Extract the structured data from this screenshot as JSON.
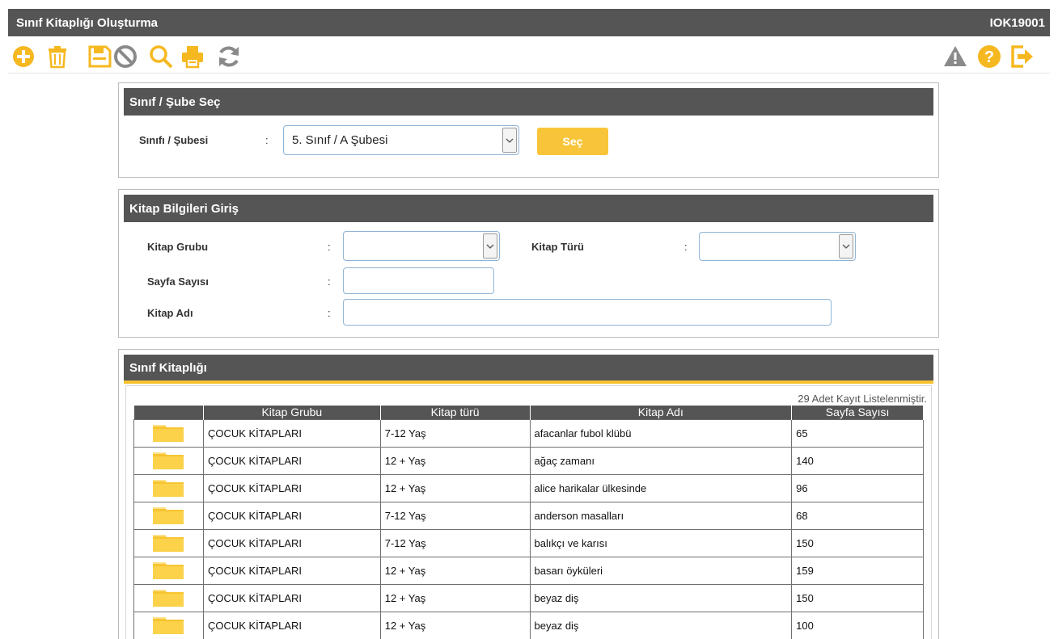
{
  "window": {
    "title": "Sınıf Kitaplığı Oluşturma",
    "code": "IOK19001"
  },
  "toolbar": {
    "left_icons": [
      "add-icon",
      "trash-icon",
      "save-icon",
      "cancel-icon",
      "search-icon",
      "print-icon",
      "refresh-icon"
    ],
    "right_icons": [
      "warning-icon",
      "help-icon",
      "exit-icon"
    ],
    "colors": {
      "accent": "#f6b820",
      "grey": "#8a8a8a"
    }
  },
  "class_panel": {
    "title": "Sınıf / Şube  Seç",
    "label": "Sınıfı / Şubesi",
    "colon": ":",
    "selected": "5. Sınıf / A Şubesi",
    "button": "Seç"
  },
  "book_panel": {
    "title": "Kitap Bilgileri Giriş",
    "colon": ":",
    "group_label": "Kitap Grubu",
    "group_value": "",
    "type_label": "Kitap Türü",
    "type_value": "",
    "pages_label": "Sayfa Sayısı",
    "pages_value": "",
    "name_label": "Kitap Adı",
    "name_value": ""
  },
  "library_panel": {
    "title": "Sınıf Kitaplığı",
    "count_text": "29 Adet Kayıt Listelenmiştir.",
    "columns": [
      "",
      "Kitap Grubu",
      "Kitap türü",
      "Kitap Adı",
      "Sayfa Sayısı"
    ],
    "rows": [
      {
        "group": "ÇOCUK KİTAPLARI",
        "type": "7-12 Yaş",
        "name": "afacanlar fubol klübü",
        "pages": "65"
      },
      {
        "group": "ÇOCUK KİTAPLARI",
        "type": "12 + Yaş",
        "name": "ağaç zamanı",
        "pages": "140"
      },
      {
        "group": "ÇOCUK KİTAPLARI",
        "type": "12 + Yaş",
        "name": "alice harikalar ülkesinde",
        "pages": "96"
      },
      {
        "group": "ÇOCUK KİTAPLARI",
        "type": "7-12 Yaş",
        "name": "anderson masalları",
        "pages": "68"
      },
      {
        "group": "ÇOCUK KİTAPLARI",
        "type": "7-12 Yaş",
        "name": "balıkçı ve karısı",
        "pages": "150"
      },
      {
        "group": "ÇOCUK KİTAPLARI",
        "type": "12 + Yaş",
        "name": "basarı öyküleri",
        "pages": "159"
      },
      {
        "group": "ÇOCUK KİTAPLARI",
        "type": "12 + Yaş",
        "name": "beyaz diş",
        "pages": "150"
      },
      {
        "group": "ÇOCUK KİTAPLARI",
        "type": "12 + Yaş",
        "name": "beyaz diş",
        "pages": "100"
      }
    ]
  }
}
